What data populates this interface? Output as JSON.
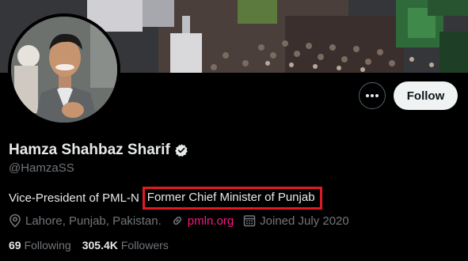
{
  "profile": {
    "display_name": "Hamza Shahbaz Sharif",
    "handle": "@HamzaSS",
    "bio_prefix": "Vice-President of PML-N",
    "bio_highlight": "Former Chief Minister of Punjab",
    "location": "Lahore, Punjab, Pakistan.",
    "website": "pmln.org",
    "joined": "Joined July 2020",
    "following_count": "69",
    "following_label": "Following",
    "followers_count": "305.4K",
    "followers_label": "Followers"
  },
  "actions": {
    "follow_label": "Follow",
    "more_icon": "more-horizontal-icon"
  },
  "icons": {
    "verified": "verified-badge-icon",
    "location": "location-pin-icon",
    "link": "link-icon",
    "calendar": "calendar-icon"
  },
  "colors": {
    "background": "#000000",
    "primary_text": "#e7e9ea",
    "secondary_text": "#71767b",
    "link": "#f91880",
    "follow_button_bg": "#eff3f4",
    "highlight_border": "#e01b24"
  }
}
